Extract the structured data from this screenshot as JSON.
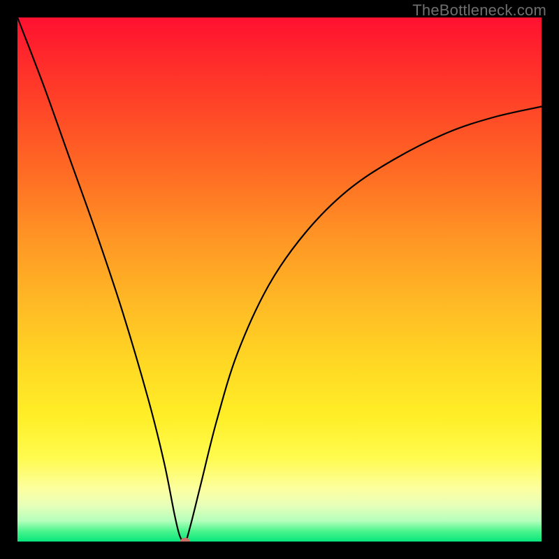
{
  "watermark": "TheBottleneck.com",
  "chart_data": {
    "type": "line",
    "title": "",
    "xlabel": "",
    "ylabel": "",
    "xlim": [
      0,
      100
    ],
    "ylim": [
      0,
      100
    ],
    "grid": false,
    "legend": false,
    "series": [
      {
        "name": "bottleneck-curve",
        "x": [
          0,
          5,
          10,
          15,
          20,
          25,
          28,
          30,
          31,
          32,
          33,
          35,
          38,
          42,
          48,
          55,
          63,
          72,
          82,
          91,
          100
        ],
        "values": [
          100,
          87,
          73,
          59,
          44,
          27,
          15,
          5,
          1,
          0,
          3,
          11,
          23,
          36,
          49,
          59,
          67,
          73,
          78,
          81,
          83
        ]
      }
    ],
    "marker": {
      "x": 32,
      "y": 0,
      "color": "#cc6f66"
    },
    "gradient_stops": [
      {
        "pos": 0,
        "color": "#ff1030"
      },
      {
        "pos": 8,
        "color": "#ff2a2b"
      },
      {
        "pos": 18,
        "color": "#ff4827"
      },
      {
        "pos": 30,
        "color": "#ff6d24"
      },
      {
        "pos": 42,
        "color": "#ff9525"
      },
      {
        "pos": 54,
        "color": "#ffb825"
      },
      {
        "pos": 66,
        "color": "#ffd824"
      },
      {
        "pos": 76,
        "color": "#ffee27"
      },
      {
        "pos": 84,
        "color": "#fffb4e"
      },
      {
        "pos": 90,
        "color": "#fcffa0"
      },
      {
        "pos": 93,
        "color": "#e8ffb8"
      },
      {
        "pos": 96,
        "color": "#b6ffbc"
      },
      {
        "pos": 98,
        "color": "#4cf58e"
      },
      {
        "pos": 100,
        "color": "#08e57b"
      }
    ]
  }
}
